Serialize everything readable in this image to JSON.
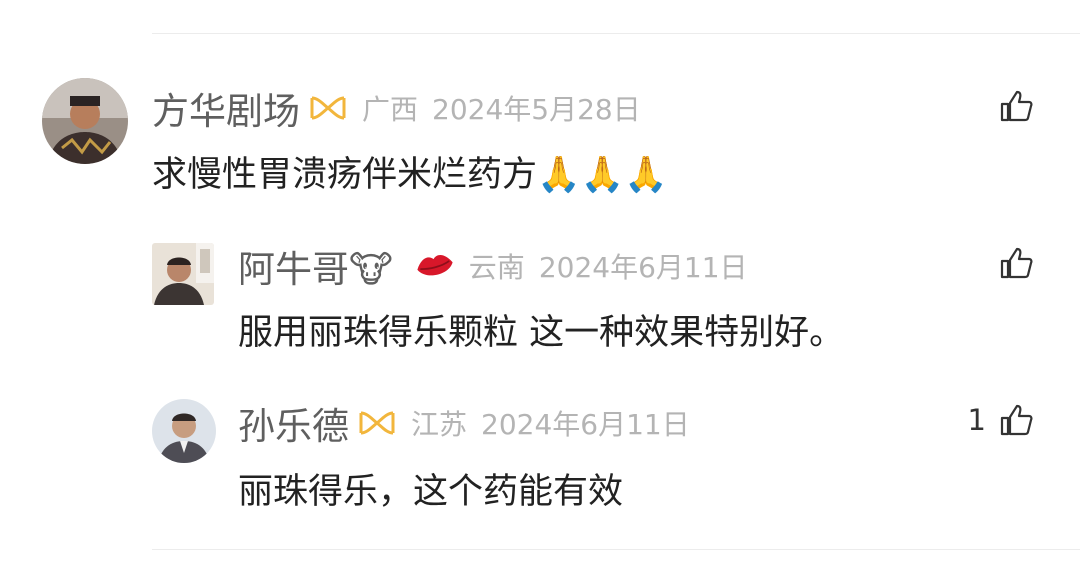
{
  "comments": [
    {
      "name": "方华剧场",
      "location": "广西",
      "date": "2024年5月28日",
      "text": "求慢性胃溃疡伴米烂药方🙏🙏🙏",
      "badge_icon": "gold-ring-badge-icon",
      "like_count": ""
    }
  ],
  "replies": [
    {
      "name": "阿牛哥🐮",
      "location": "云南",
      "date": "2024年6月11日",
      "text": "服用丽珠得乐颗粒  这一种效果特别好。",
      "badge_icon": "red-lips-icon",
      "like_count": ""
    },
    {
      "name": "孙乐德",
      "location": "江苏",
      "date": "2024年6月11日",
      "text": "丽珠得乐，这个药能有效",
      "badge_icon": "gold-ring-badge-icon",
      "like_count": "1"
    }
  ],
  "colors": {
    "name": "#5f5f5f",
    "meta": "#b4b4b4",
    "text": "#222222",
    "badge_gold": "#f2b63c",
    "lips_red": "#d8172a"
  }
}
